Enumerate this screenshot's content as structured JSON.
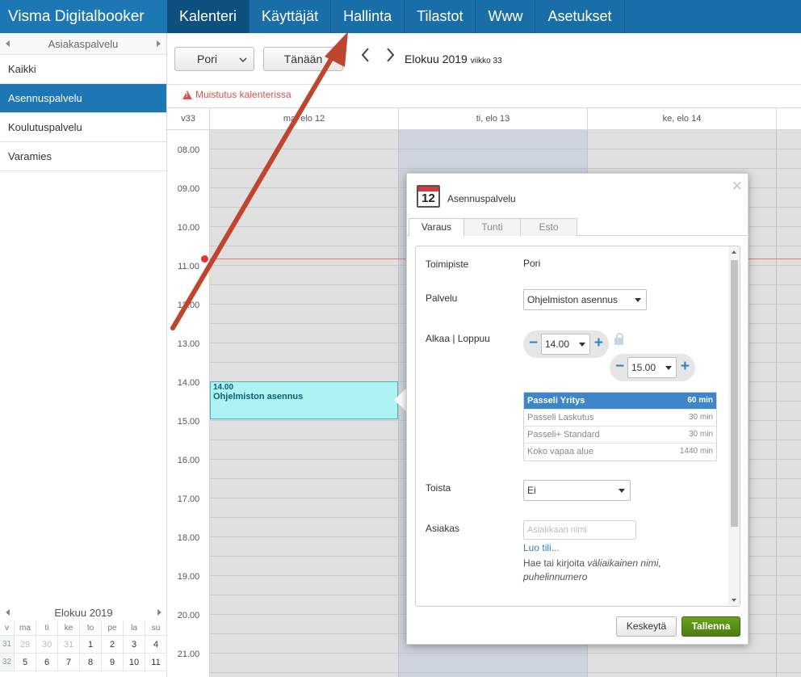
{
  "app": {
    "title": "Visma Digitalbooker"
  },
  "nav": {
    "items": [
      "Kalenteri",
      "Käyttäjät",
      "Hallinta",
      "Tilastot",
      "Www",
      "Asetukset"
    ]
  },
  "sidebar": {
    "header": "Asiakaspalvelu",
    "items": [
      "Kaikki",
      "Asennuspalvelu",
      "Koulutuspalvelu",
      "Varamies"
    ]
  },
  "mini_calendar": {
    "title": "Elokuu 2019",
    "day_headers": [
      "v",
      "ma",
      "ti",
      "ke",
      "to",
      "pe",
      "la",
      "su"
    ],
    "weeks": [
      [
        "31",
        "29",
        "30",
        "31",
        "1",
        "2",
        "3",
        "4"
      ],
      [
        "32",
        "5",
        "6",
        "7",
        "8",
        "9",
        "10",
        "11"
      ]
    ]
  },
  "toolbar": {
    "location": "Pori",
    "today": "Tänään",
    "date_title": "Elokuu 2019",
    "week_label": "viikko 33"
  },
  "reminder": "Muistutus kalenterissa",
  "calendar": {
    "week": "v33",
    "days": [
      "ma, elo 12",
      "ti, elo 13",
      "ke, elo 14"
    ],
    "times": [
      "08.00",
      "09.00",
      "10.00",
      "11.00",
      "12.00",
      "13.00",
      "14.00",
      "15.00",
      "16.00",
      "17.00",
      "18.00",
      "19.00",
      "20.00",
      "21.00"
    ],
    "event": {
      "time": "14.00",
      "title": "Ohjelmiston asennus"
    }
  },
  "popup": {
    "icon_day": "12",
    "title": "Asennuspalvelu",
    "tabs": [
      "Varaus",
      "Tunti",
      "Esto"
    ],
    "fields": {
      "location_label": "Toimipiste",
      "location_value": "Pori",
      "service_label": "Palvelu",
      "service_value": "Ohjelmiston asennus",
      "time_label": "Alkaa | Loppuu",
      "start": "14.00",
      "end": "15.00",
      "repeat_label": "Toista",
      "repeat_value": "Ei",
      "customer_label": "Asiakas",
      "customer_placeholder": "Asiakkaan nimi",
      "create_account": "Luo tili...",
      "hint_1": "Hae tai kirjoita",
      "hint_2": "väliaikainen nimi, puhelinnumero"
    },
    "services": [
      {
        "name": "Passeli Yritys",
        "duration": "60 min"
      },
      {
        "name": "Passeli Laskutus",
        "duration": "30 min"
      },
      {
        "name": "Passeli+ Standard",
        "duration": "30 min"
      },
      {
        "name": "Koko vapaa alue",
        "duration": "1440 min"
      }
    ],
    "cancel": "Keskeytä",
    "save": "Tallenna"
  },
  "colors": {
    "nav_bg": "#1a6ea8",
    "active_nav": "#0d4f7d",
    "sidebar_active": "#1e77b5",
    "event_bg": "#aef3f3",
    "save_button": "#5a8f18",
    "annotation_arrow": "#c0452f",
    "reminder": "#d9534f"
  }
}
